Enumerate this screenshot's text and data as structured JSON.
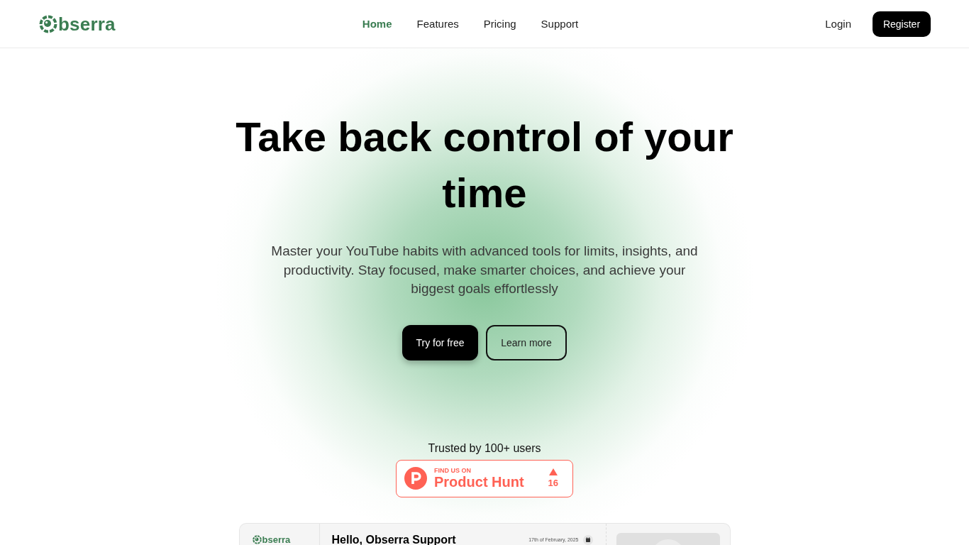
{
  "header": {
    "logo": {
      "text": "bserra"
    },
    "nav": [
      {
        "label": "Home",
        "selected": true
      },
      {
        "label": "Features",
        "selected": false
      },
      {
        "label": "Pricing",
        "selected": false
      },
      {
        "label": "Support",
        "selected": false
      }
    ],
    "login": "Login",
    "register": "Register"
  },
  "hero": {
    "title": "Take back control of your time",
    "subtitle": "Master your YouTube habits with advanced tools for limits, insights, and productivity. Stay focused, make smarter choices, and achieve your biggest goals effortlessly",
    "buttons": [
      {
        "label": "Try for free",
        "kind": "primary"
      },
      {
        "label": "Learn more",
        "kind": "secondary"
      }
    ]
  },
  "trust": {
    "text": "Trusted by 100+ users",
    "badge": {
      "caption": "FIND US ON",
      "name": "Product Hunt",
      "votes": "16"
    }
  },
  "preview": {
    "logo": {
      "text": "bserra"
    },
    "greeting": "Hello, Obserra Support",
    "date": "17th of February, 2025"
  }
}
